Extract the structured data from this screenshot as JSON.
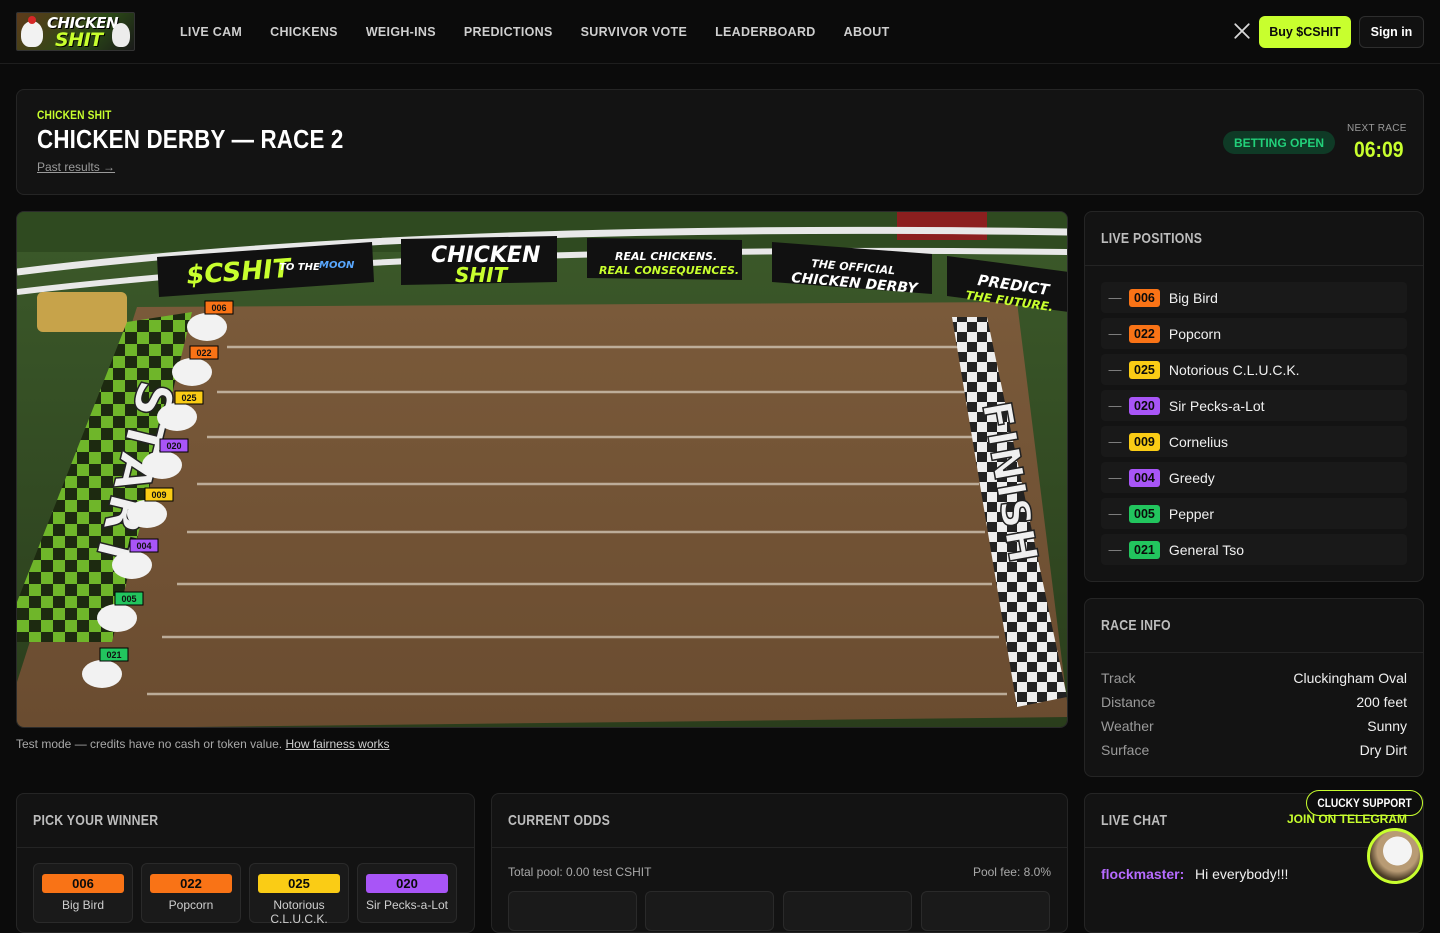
{
  "nav": {
    "logo_line1": "CHICKEN",
    "logo_line2": "SHIT",
    "links": [
      "LIVE CAM",
      "CHICKENS",
      "WEIGH-INS",
      "PREDICTIONS",
      "SURVIVOR VOTE",
      "LEADERBOARD",
      "ABOUT"
    ],
    "buy_label": "Buy $CSHIT",
    "signin_label": "Sign in"
  },
  "header": {
    "eyebrow": "CHICKEN SHIT",
    "title": "CHICKEN DERBY — RACE 2",
    "past_link": "Past results →",
    "status": "BETTING OPEN",
    "next_label": "NEXT RACE",
    "countdown": "06:09"
  },
  "track": {
    "banners": [
      "$CSHIT",
      "TO THE",
      "MOON",
      "CHICKEN",
      "SHIT",
      "REAL CHICKENS.",
      "REAL CONSEQUENCES.",
      "THE OFFICIAL",
      "CHICKEN DERBY",
      "PREDICT",
      "THE FUTURE."
    ],
    "start_text": "START",
    "finish_text": "FINISH",
    "test_note": "Test mode — credits have no cash or token value.",
    "fairness_link": "How fairness works"
  },
  "positions": {
    "title": "LIVE POSITIONS",
    "rows": [
      {
        "dash": "—",
        "num": "006",
        "name": "Big Bird",
        "color": "#f97316"
      },
      {
        "dash": "—",
        "num": "022",
        "name": "Popcorn",
        "color": "#f97316"
      },
      {
        "dash": "—",
        "num": "025",
        "name": "Notorious C.L.U.C.K.",
        "color": "#facc15"
      },
      {
        "dash": "—",
        "num": "020",
        "name": "Sir Pecks-a-Lot",
        "color": "#a855f7"
      },
      {
        "dash": "—",
        "num": "009",
        "name": "Cornelius",
        "color": "#facc15"
      },
      {
        "dash": "—",
        "num": "004",
        "name": "Greedy",
        "color": "#a855f7"
      },
      {
        "dash": "—",
        "num": "005",
        "name": "Pepper",
        "color": "#22c55e"
      },
      {
        "dash": "—",
        "num": "021",
        "name": "General Tso",
        "color": "#22c55e"
      }
    ]
  },
  "race_info": {
    "title": "RACE INFO",
    "rows": [
      {
        "k": "Track",
        "v": "Cluckingham Oval"
      },
      {
        "k": "Distance",
        "v": "200 feet"
      },
      {
        "k": "Weather",
        "v": "Sunny"
      },
      {
        "k": "Surface",
        "v": "Dry Dirt"
      }
    ]
  },
  "pick": {
    "title": "PICK YOUR WINNER",
    "tiles": [
      {
        "num": "006",
        "name": "Big Bird",
        "color": "#f97316"
      },
      {
        "num": "022",
        "name": "Popcorn",
        "color": "#f97316"
      },
      {
        "num": "025",
        "name": "Notorious C.L.U.C.K.",
        "color": "#facc15"
      },
      {
        "num": "020",
        "name": "Sir Pecks-a-Lot",
        "color": "#a855f7"
      }
    ]
  },
  "odds": {
    "title": "CURRENT ODDS",
    "pool": "Total pool: 0.00 test CSHIT",
    "fee": "Pool fee: 8.0%"
  },
  "chat": {
    "title": "LIVE CHAT",
    "user": "flockmaster:",
    "message": "Hi everybody!!!"
  },
  "support": {
    "pill": "CLUCKY SUPPORT",
    "telegram": "JOIN ON TELEGRAM"
  },
  "colors": {
    "accent": "#c8ff2e",
    "open_green": "#22d07a",
    "chat_user": "#b66bff"
  }
}
